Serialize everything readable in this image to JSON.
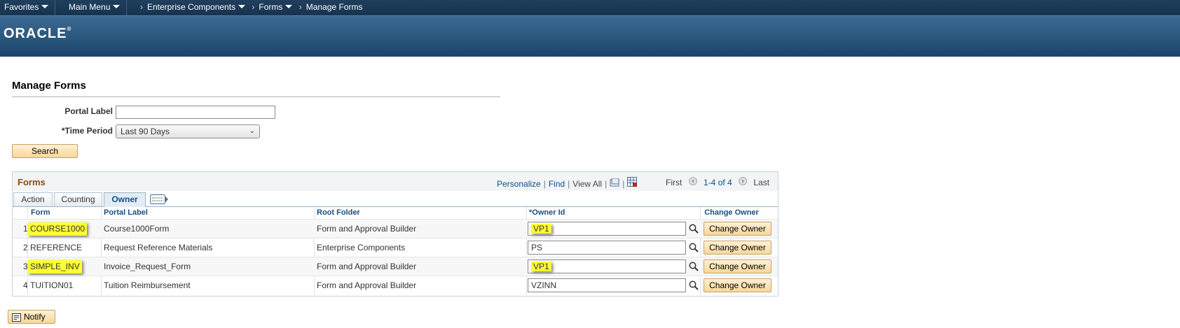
{
  "topbar": {
    "favorites": "Favorites",
    "main_menu": "Main Menu",
    "breadcrumb": [
      "Enterprise Components",
      "Forms",
      "Manage Forms"
    ]
  },
  "brand": {
    "logo_text": "ORACLE"
  },
  "page": {
    "title": "Manage Forms",
    "portal_label_label": "Portal Label",
    "portal_label_value": "",
    "time_period_label": "*Time Period",
    "time_period_value": "Last 90 Days",
    "search_button": "Search",
    "notify_button": "Notify"
  },
  "grid": {
    "title": "Forms",
    "personalize": "Personalize",
    "find": "Find",
    "view_all": "View All",
    "first": "First",
    "range": "1-4 of 4",
    "last": "Last",
    "tabs": [
      "Action",
      "Counting",
      "Owner"
    ],
    "active_tab": "Owner",
    "columns": [
      "Form",
      "Portal Label",
      "Root Folder",
      "*Owner Id",
      "Change Owner"
    ],
    "change_owner_label": "Change Owner",
    "rows": [
      {
        "num": "1",
        "form": "COURSE1000",
        "portal_label": "Course1000Form",
        "root_folder": "Form and Approval Builder",
        "owner_id": "VP1",
        "highlighted": true
      },
      {
        "num": "2",
        "form": "REFERENCE",
        "portal_label": "Request Reference Materials",
        "root_folder": "Enterprise Components",
        "owner_id": "PS",
        "highlighted": false
      },
      {
        "num": "3",
        "form": "SIMPLE_INV",
        "portal_label": "Invoice_Request_Form",
        "root_folder": "Form and Approval Builder",
        "owner_id": "VP1",
        "highlighted": true
      },
      {
        "num": "4",
        "form": "TUITION01",
        "portal_label": "Tuition Reimbursement",
        "root_folder": "Form and Approval Builder",
        "owner_id": "VZINN",
        "highlighted": false
      }
    ]
  },
  "colors": {
    "highlight": "#ffff33",
    "header_bg": "#17334f",
    "grid_title": "#8a4b13"
  }
}
